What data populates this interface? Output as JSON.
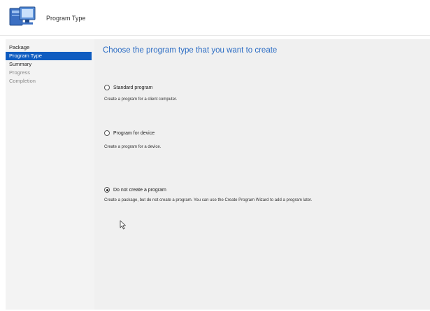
{
  "window": {
    "title": "Program Type"
  },
  "sidebar": {
    "items": [
      {
        "label": "Package",
        "state": "done"
      },
      {
        "label": "Program Type",
        "state": "selected"
      },
      {
        "label": "Summary",
        "state": "done"
      },
      {
        "label": "Progress",
        "state": "pending"
      },
      {
        "label": "Completion",
        "state": "pending"
      }
    ]
  },
  "main": {
    "heading": "Choose the program type that you want to create",
    "options": [
      {
        "label": "Standard program",
        "description": "Create a program for a client computer.",
        "selected": false
      },
      {
        "label": "Program for device",
        "description": "Create a program for a device.",
        "selected": false
      },
      {
        "label": "Do not create a program",
        "description": "Create a package, but do not create a program. You can use the Create Program Wizard to add a program later.",
        "selected": true
      }
    ]
  },
  "colors": {
    "accent": "#0f5cc0",
    "heading": "#2b6cc4",
    "content_bg": "#f0f0f0",
    "sidebar_bg": "#f3f3f3"
  },
  "icons": {
    "header": "computer-package-icon",
    "cursor": "mouse-pointer-icon"
  }
}
